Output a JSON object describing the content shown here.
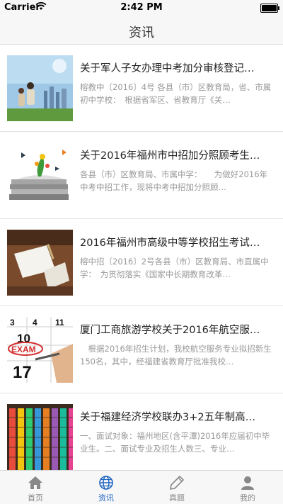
{
  "status": {
    "carrier": "Carrier",
    "time": "2:42 PM"
  },
  "nav": {
    "title": "资讯"
  },
  "articles": [
    {
      "title": "关于军人子女办理中考加分审核登记…",
      "summary": "榕教中〔2016〕4号 各县（市）区教育局，省、市属初中学校：　根据省军区、省教育厅《关…"
    },
    {
      "title": "关于2016年福州市中招加分照顾考生…",
      "summary": "各县（市）区教育局、市属中学：　　为做好2016年中考中招工作，现将中考中招加分照顾…"
    },
    {
      "title": "2016年福州市高级中等学校招生考试…",
      "summary": "榕中招〔2016〕2号各县（市）区教育局、市直属中学：　为贯彻落实《国家中长期教育改革…"
    },
    {
      "title": "厦门工商旅游学校关于2016年航空服…",
      "summary": "　根据2016年招生计划，我校航空服务专业拟招新生150名，其中，经福建省教育厅批准我校…"
    },
    {
      "title": "关于福建经济学校联办3+2五年制高…",
      "summary": "一、面试对象：福州地区(含平潭)2016年应届初中毕业生。二、面试专业及招生人数三、专业…"
    }
  ],
  "tabs": [
    {
      "label": "首页",
      "icon": "home-icon",
      "active": false
    },
    {
      "label": "资讯",
      "icon": "globe-icon",
      "active": true
    },
    {
      "label": "真题",
      "icon": "pencil-icon",
      "active": false
    },
    {
      "label": "我的",
      "icon": "person-icon",
      "active": false
    }
  ],
  "colors": {
    "accent": "#1f66c2",
    "inactive": "#888888",
    "background": "#f2f2f2"
  }
}
